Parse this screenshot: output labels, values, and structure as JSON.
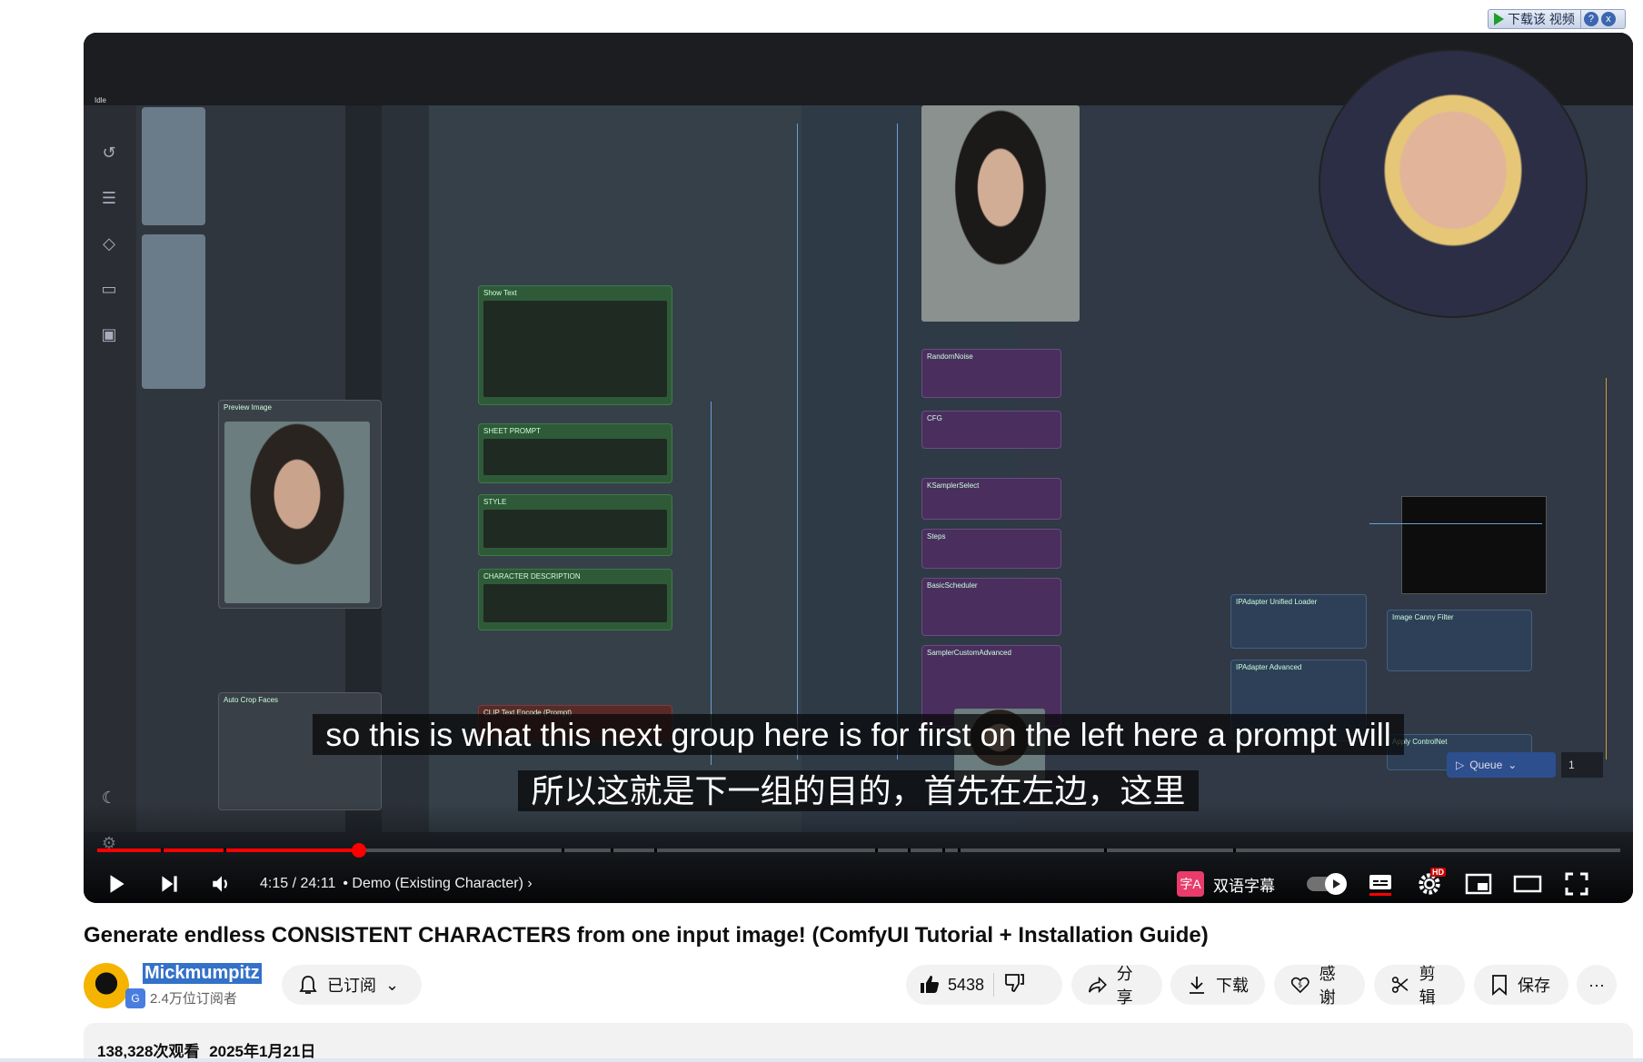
{
  "download_helper": {
    "label": "下载该 视频",
    "help": "?",
    "close": "x"
  },
  "video": {
    "comfy_status": "Idle",
    "subtitle_en": "so this is what this next group here is for first on the left here a prompt will",
    "subtitle_zh": "所以这就是下一组的目的，首先在左边，这里",
    "queue_label": "Queue",
    "queue_count": "1",
    "nodes": {
      "show_text": "Show Text",
      "sheet_prompt": "SHEET PROMPT",
      "style": "STYLE",
      "character_description": "CHARACTER DESCRIPTION",
      "clip_text_encode": "CLIP Text Encode (Prompt)",
      "random_noise": "RandomNoise",
      "cfg": "CFG",
      "ksampler_select": "KSamplerSelect",
      "steps": "Steps",
      "basic_scheduler": "BasicScheduler",
      "sampler_custom_advanced": "SamplerCustomAdvanced",
      "preview_image": "Preview Image",
      "auto_crop_faces": "Auto Crop Faces",
      "ipadapter_unified_loader": "IPAdapter Unified Loader",
      "ipadapter_advanced": "IPAdapter Advanced",
      "apply_controlnet": "Apply ControlNet",
      "image_canny_filter": "Image Canny Filter"
    }
  },
  "controls": {
    "time_current": "4:15",
    "time_total": "24:11",
    "chapter": "Demo (Existing Character)",
    "bilingual_label": "双语字幕",
    "bilingual_icon": "字A",
    "hd_badge": "HD",
    "progress_fraction": 0.172,
    "chapter_marks": [
      0.042,
      0.083,
      0.305,
      0.337,
      0.366,
      0.511,
      0.532,
      0.555,
      0.565,
      0.661,
      0.746
    ],
    "accent_color": "#ff0000"
  },
  "title": "Generate endless CONSISTENT CHARACTERS from one input image! (ComfyUI Tutorial + Installation Guide)",
  "channel": {
    "name": "Mickmumpitz",
    "subscribers": "2.4万位订阅者",
    "subscribe_label": "已订阅"
  },
  "actions": {
    "likes": "5438",
    "share": "分享",
    "download": "下载",
    "thanks": "感谢",
    "clip": "剪辑",
    "save": "保存",
    "more": "···"
  },
  "stats": {
    "views": "138,328次观看",
    "date": "2025年1月21日"
  }
}
